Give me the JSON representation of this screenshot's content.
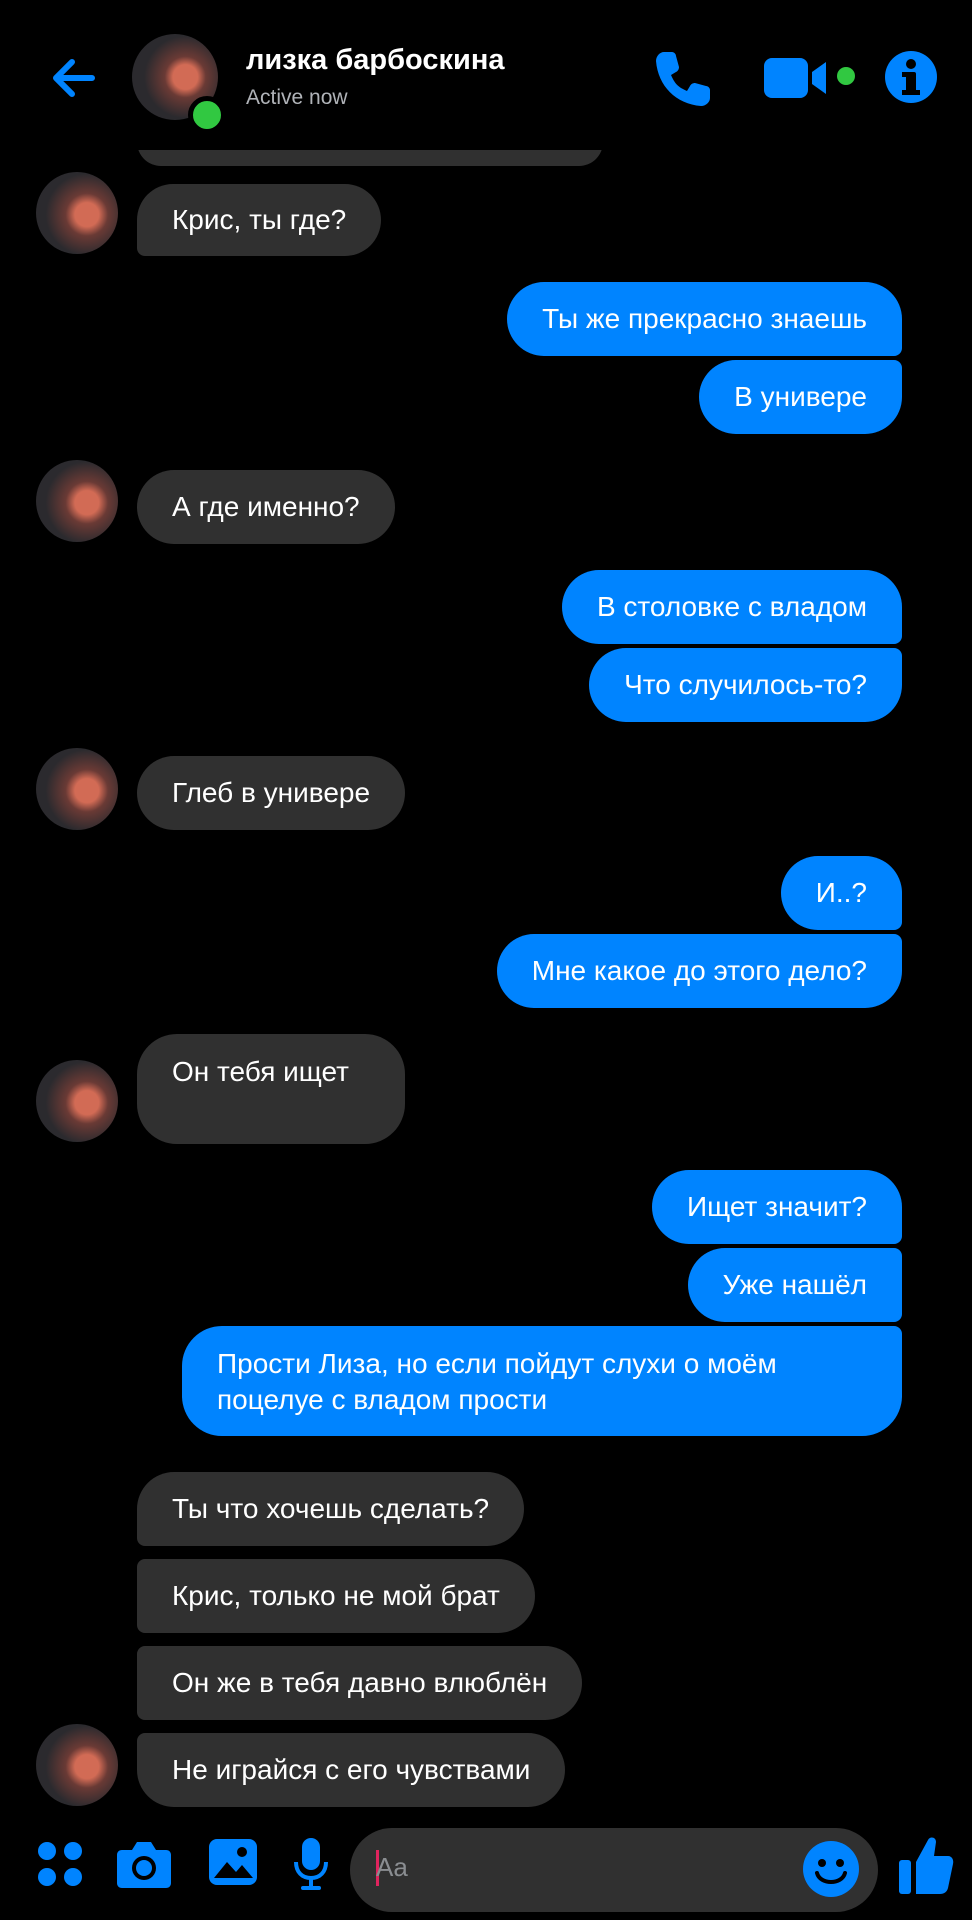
{
  "header": {
    "back_icon": "arrow-left-icon",
    "contact_name": "лизка барбоскина",
    "status": "Active now",
    "icons": [
      "phone-icon",
      "video-camera-icon",
      "info-icon"
    ],
    "accent_color": "#0084ff",
    "online_color": "#31c841"
  },
  "messages": [
    {
      "side": "in",
      "text": "Крис, ты где?"
    },
    {
      "side": "out",
      "text": "Ты же прекрасно знаешь"
    },
    {
      "side": "out",
      "text": "В универе"
    },
    {
      "side": "in",
      "text": "А где именно?"
    },
    {
      "side": "out",
      "text": "В столовке с владом"
    },
    {
      "side": "out",
      "text": "Что случилось-то?"
    },
    {
      "side": "in",
      "text": "Глеб в универе"
    },
    {
      "side": "out",
      "text": "И..?"
    },
    {
      "side": "out",
      "text": "Мне какое до этого дело?"
    },
    {
      "side": "in",
      "text": "Он тебя ищет"
    },
    {
      "side": "out",
      "text": "Ищет значит?"
    },
    {
      "side": "out",
      "text": "Уже нашёл"
    },
    {
      "side": "out",
      "text": "Прости Лиза, но если пойдут слухи о моём поцелуе с владом прости"
    },
    {
      "side": "in",
      "text": "Ты что хочешь сделать?"
    },
    {
      "side": "in",
      "text": "Крис, только не мой брат"
    },
    {
      "side": "in",
      "text": "Он же в тебя давно влюблён"
    },
    {
      "side": "in",
      "text": "Не играйся с его чувствами"
    }
  ],
  "composer": {
    "placeholder": "Aa",
    "icons": [
      "apps-grid-icon",
      "camera-icon",
      "gallery-icon",
      "microphone-icon",
      "emoji-icon",
      "thumbs-up-icon"
    ]
  },
  "colors": {
    "background": "#000000",
    "incoming_bubble": "#303030",
    "outgoing_bubble": "#0084ff"
  }
}
